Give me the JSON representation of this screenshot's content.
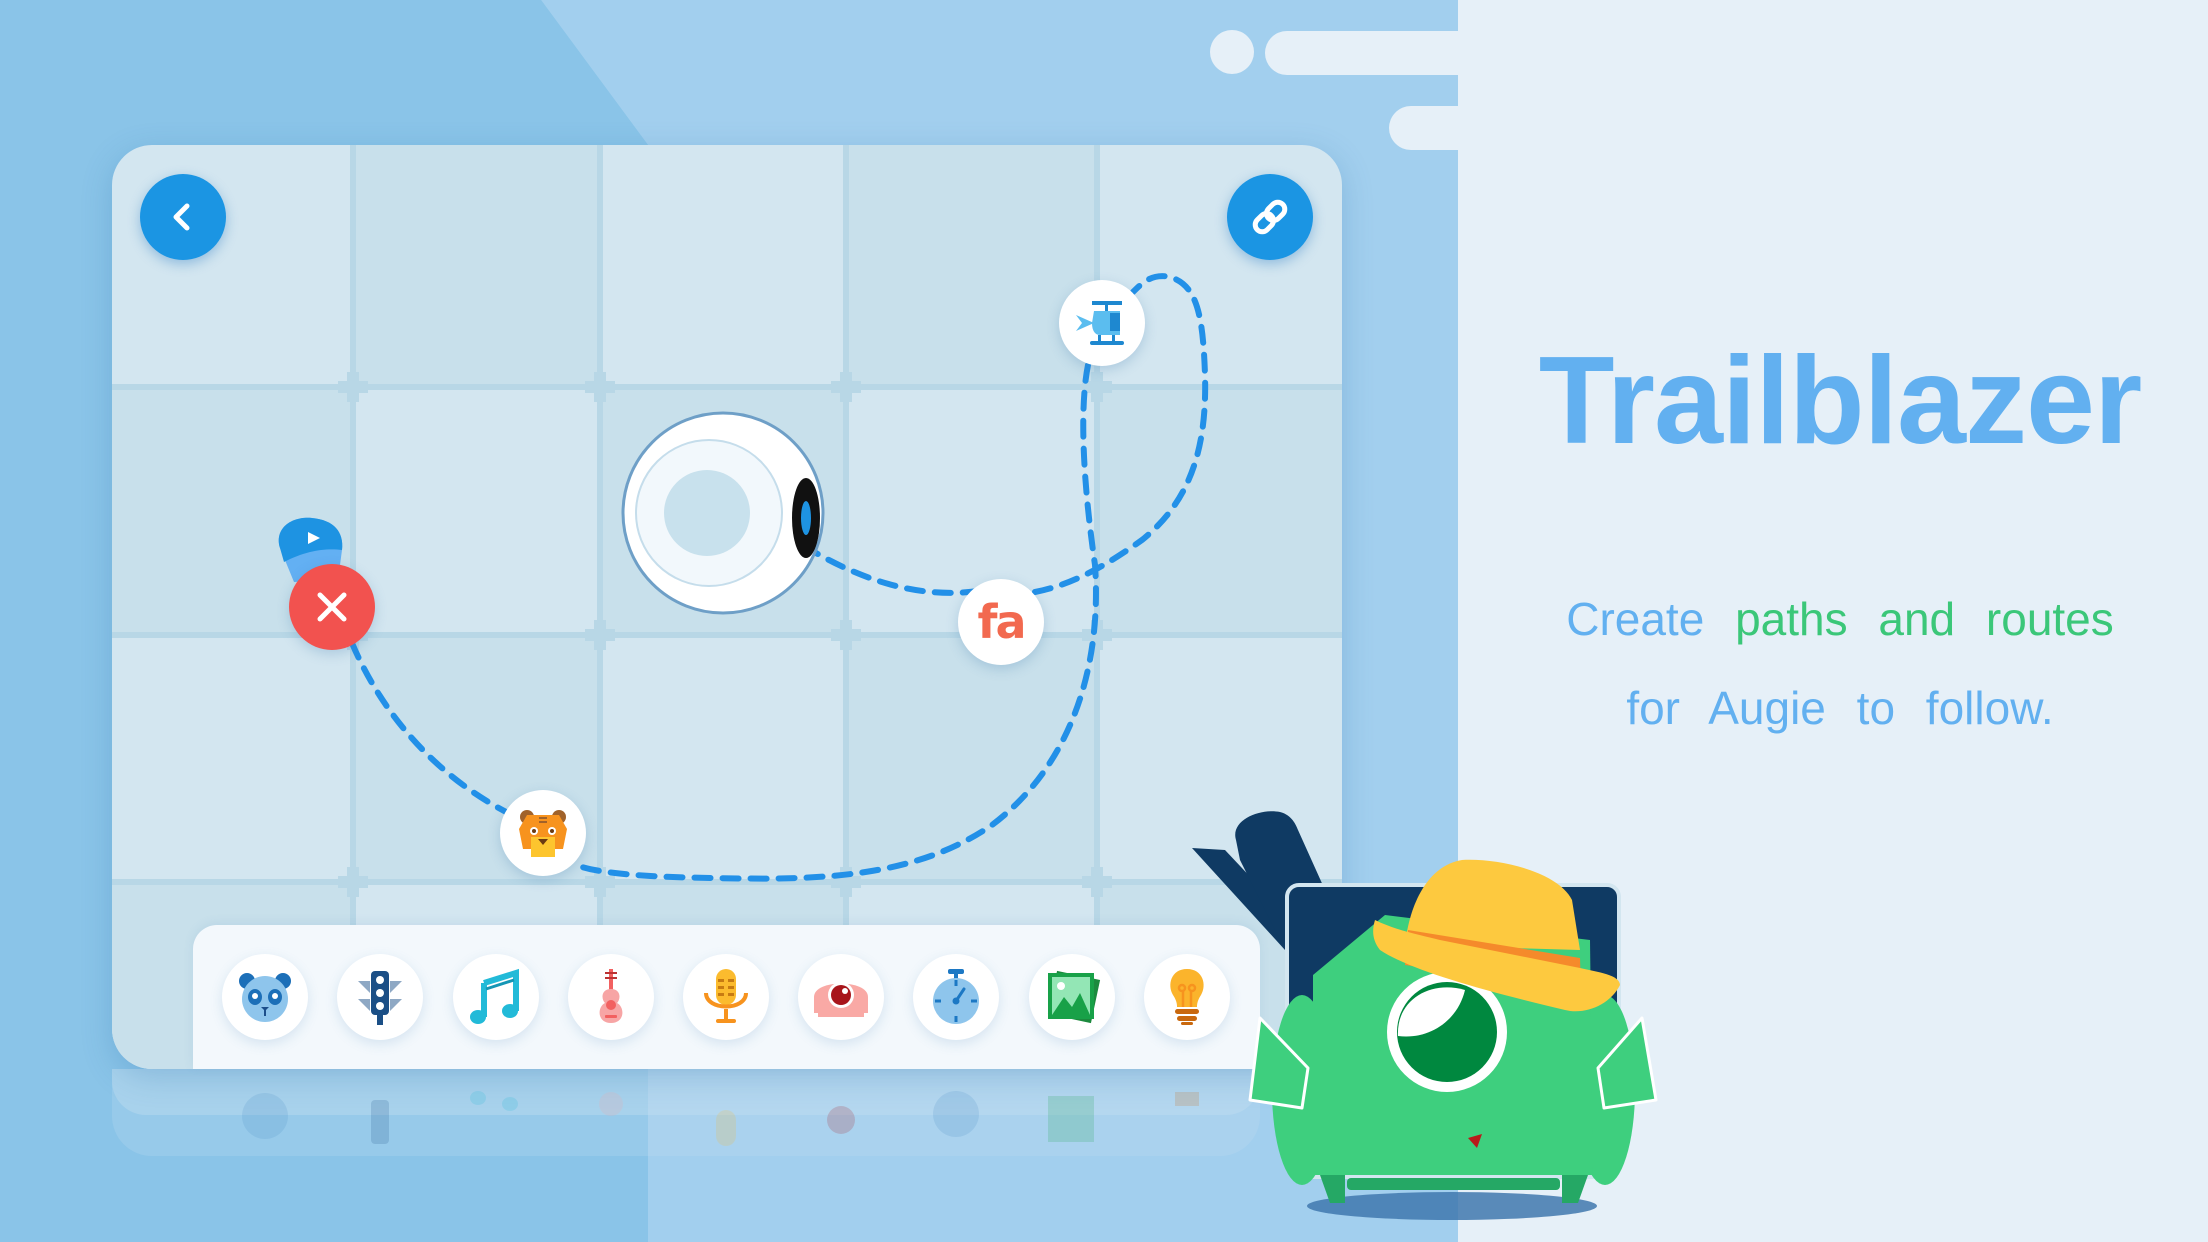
{
  "app": {
    "title": "Trailblazer",
    "subtitle": {
      "line1": [
        {
          "text": "Create",
          "highlight": false
        },
        {
          "text": "paths",
          "highlight": true
        },
        {
          "text": "and",
          "highlight": true
        },
        {
          "text": "routes",
          "highlight": true
        }
      ],
      "line2": "for Augie to follow."
    }
  },
  "colors": {
    "accent_blue": "#1B95E3",
    "title_blue": "#62B0F0",
    "highlight_green": "#3BC779",
    "path_blue": "#2290E8",
    "delete_red": "#F2524F",
    "background_blue": "#8AC4E8",
    "background_light": "#E6F0F8"
  },
  "map": {
    "back_button": {
      "icon": "chevron-left-icon",
      "label": "Back"
    },
    "link_button": {
      "icon": "link-icon",
      "label": "Link"
    },
    "start_marker": {
      "icon": "play-icon"
    },
    "delete_button": {
      "icon": "close-icon"
    },
    "robot": {
      "name": "Augie"
    },
    "waypoints": [
      {
        "id": "fa",
        "icon": "fa-text-icon",
        "label": "fa"
      },
      {
        "id": "helicopter",
        "icon": "helicopter-icon"
      },
      {
        "id": "tiger",
        "icon": "tiger-icon"
      }
    ]
  },
  "toolbar": {
    "items": [
      {
        "name": "panda",
        "icon": "panda-icon"
      },
      {
        "name": "traffic-light",
        "icon": "traffic-light-icon"
      },
      {
        "name": "music",
        "icon": "music-note-icon"
      },
      {
        "name": "guitar",
        "icon": "guitar-icon"
      },
      {
        "name": "microphone",
        "icon": "microphone-icon"
      },
      {
        "name": "camera",
        "icon": "camera-icon"
      },
      {
        "name": "stopwatch",
        "icon": "stopwatch-icon"
      },
      {
        "name": "pictures",
        "icon": "picture-icon"
      },
      {
        "name": "lightbulb",
        "icon": "lightbulb-icon"
      }
    ]
  },
  "mascot": {
    "name": "Augie",
    "accessory": "straw hat"
  }
}
